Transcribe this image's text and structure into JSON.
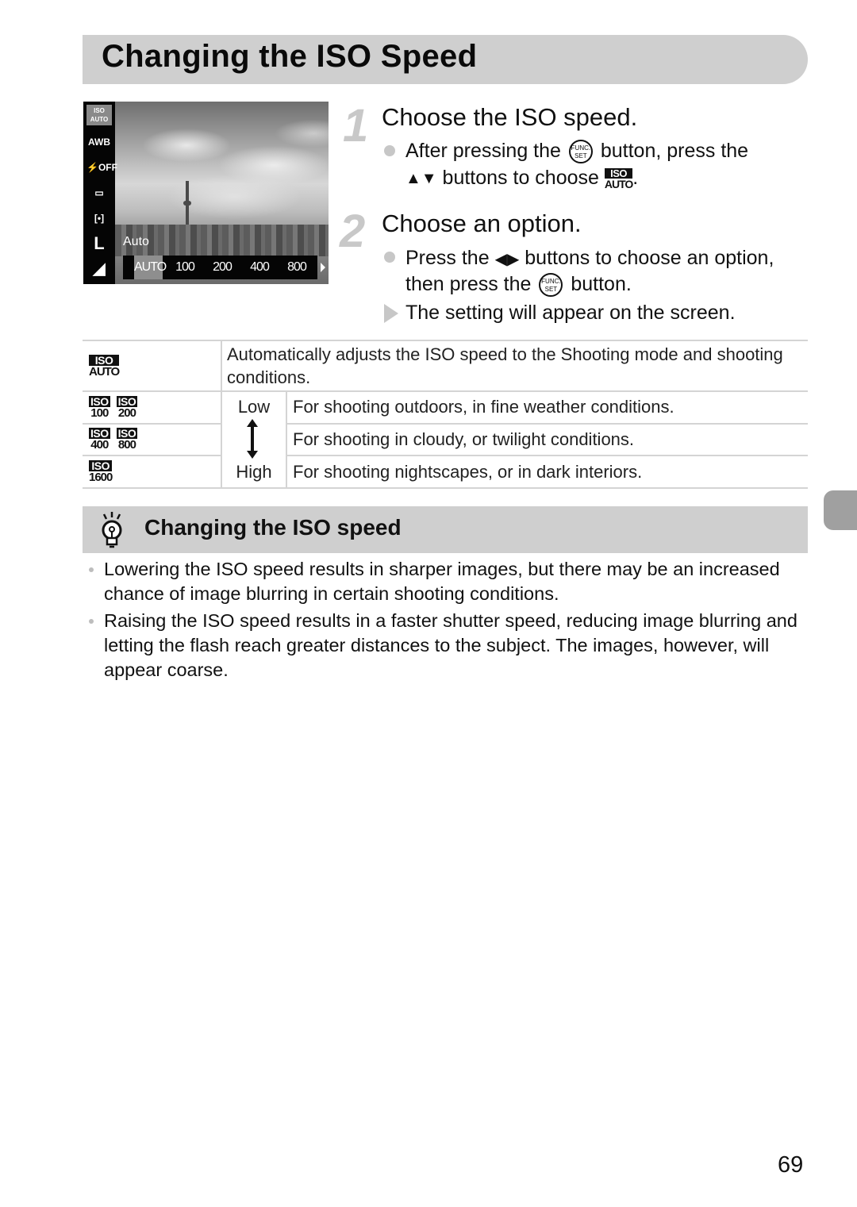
{
  "page": {
    "title": "Changing the ISO Speed",
    "page_number": "69"
  },
  "camera_screen": {
    "left_icons": [
      "ISO AUTO",
      "AWB",
      "Flash OFF",
      "Drive single",
      "Metering",
      "L",
      "Quality"
    ],
    "selected_label": "Auto",
    "iso_options": [
      "AUTO",
      "100",
      "200",
      "400",
      "800"
    ],
    "selected_index": 0
  },
  "steps": [
    {
      "number": "1",
      "title": "Choose the ISO speed.",
      "line1_a": "After pressing the",
      "line1_b": "button, press the",
      "line2_arrows": "▲▼",
      "line2_a": "buttons to choose",
      "line2_end": "."
    },
    {
      "number": "2",
      "title": "Choose an option.",
      "line1_a": "Press the",
      "line1_arrows": "◀▶",
      "line1_b": "buttons to choose an option,",
      "line2_a": "then press the",
      "line2_b": "button.",
      "result": "The setting will appear on the screen."
    }
  ],
  "func_button": {
    "top": "FUNC.",
    "bottom": "SET"
  },
  "iso_badge": {
    "top": "ISO",
    "auto": "AUTO"
  },
  "table": {
    "rows": [
      {
        "icons": [
          "AUTO"
        ],
        "level": "",
        "desc": "Automatically adjusts the ISO speed to the Shooting mode and shooting conditions."
      },
      {
        "icons": [
          "100",
          "200"
        ],
        "level": "Low",
        "desc": "For shooting outdoors, in fine weather conditions."
      },
      {
        "icons": [
          "400",
          "800"
        ],
        "level": "",
        "desc": "For shooting in cloudy, or twilight conditions."
      },
      {
        "icons": [
          "1600"
        ],
        "level": "High",
        "desc": "For shooting nightscapes, or in dark interiors."
      }
    ]
  },
  "tip": {
    "title": "Changing the ISO speed",
    "items": [
      "Lowering the ISO speed results in sharper images, but there may be an increased chance of image blurring in certain shooting conditions.",
      "Raising the ISO speed results in a faster shutter speed, reducing image blurring and letting the flash reach greater distances to the subject. The images, however, will appear coarse."
    ]
  },
  "colors": {
    "header_gray": "#cfcfcf",
    "bullet_gray": "#c7c7c7",
    "side_tab": "#a0a0a0"
  }
}
